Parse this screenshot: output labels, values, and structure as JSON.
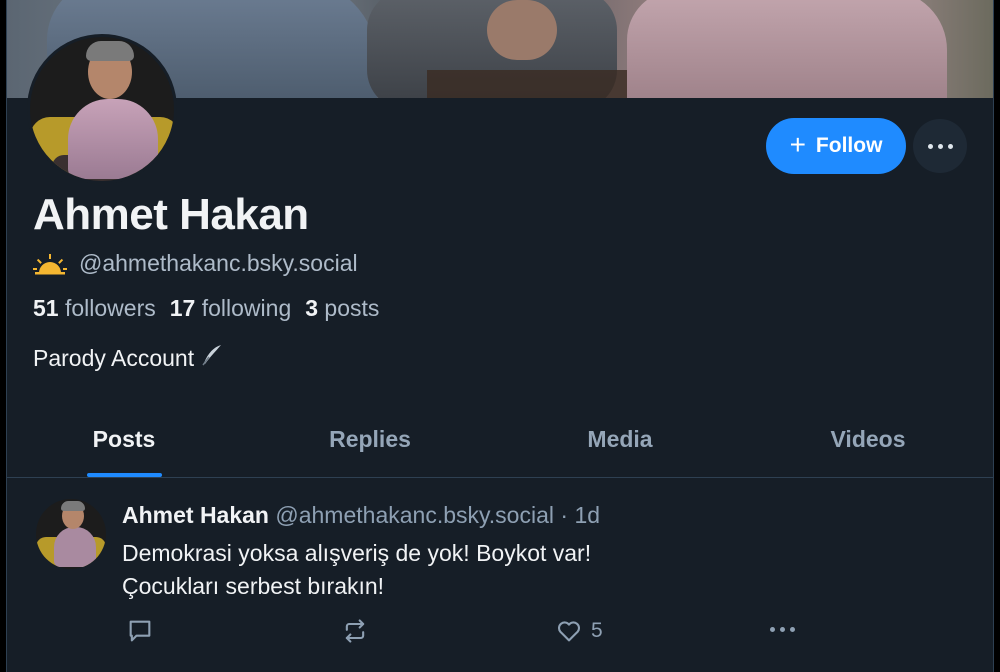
{
  "profile": {
    "display_name": "Ahmet Hakan",
    "handle": "@ahmethakanc.bsky.social",
    "followers_count": "51",
    "followers_label": "followers",
    "following_count": "17",
    "following_label": "following",
    "posts_count": "3",
    "posts_label": "posts",
    "bio": "Parody Account",
    "follow_label": "Follow"
  },
  "tabs": [
    "Posts",
    "Replies",
    "Media",
    "Videos"
  ],
  "active_tab": "Posts",
  "post": {
    "author": "Ahmet Hakan",
    "handle": "@ahmethakanc.bsky.social",
    "separator": "·",
    "time": "1d",
    "line1": "Demokrasi yoksa alışveriş de yok! Boykot var!",
    "line2": "Çocukları serbest bırakın!",
    "like_count": "5"
  },
  "colors": {
    "background": "#161e27",
    "accent": "#1f8bff",
    "muted_text": "#aebbc9",
    "primary_text": "#f1f3f5"
  }
}
